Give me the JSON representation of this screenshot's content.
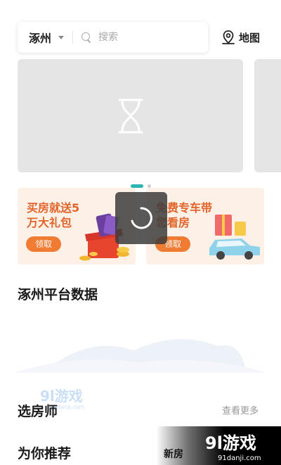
{
  "search": {
    "city": "涿州",
    "placeholder": "搜索"
  },
  "header": {
    "map_label": "地图"
  },
  "carousel": {
    "slide_count": 2,
    "active_index": 0
  },
  "promos": [
    {
      "title": "买房就送5万大礼包",
      "button": "领取"
    },
    {
      "title": "免费专车带您看房",
      "button": "领取"
    }
  ],
  "sections": {
    "platform_data_title": "涿州平台数据",
    "advisor_title": "选房师",
    "advisor_more": "查看更多",
    "recommend_title": "为你推荐",
    "recommend_tab": "新房"
  },
  "colors": {
    "accent": "#2bb6b4",
    "promo_orange": "#f07c33",
    "promo_bg": "#fdf0e6"
  },
  "watermark": {
    "brand": "9l游戏",
    "url": "91danji.com"
  }
}
